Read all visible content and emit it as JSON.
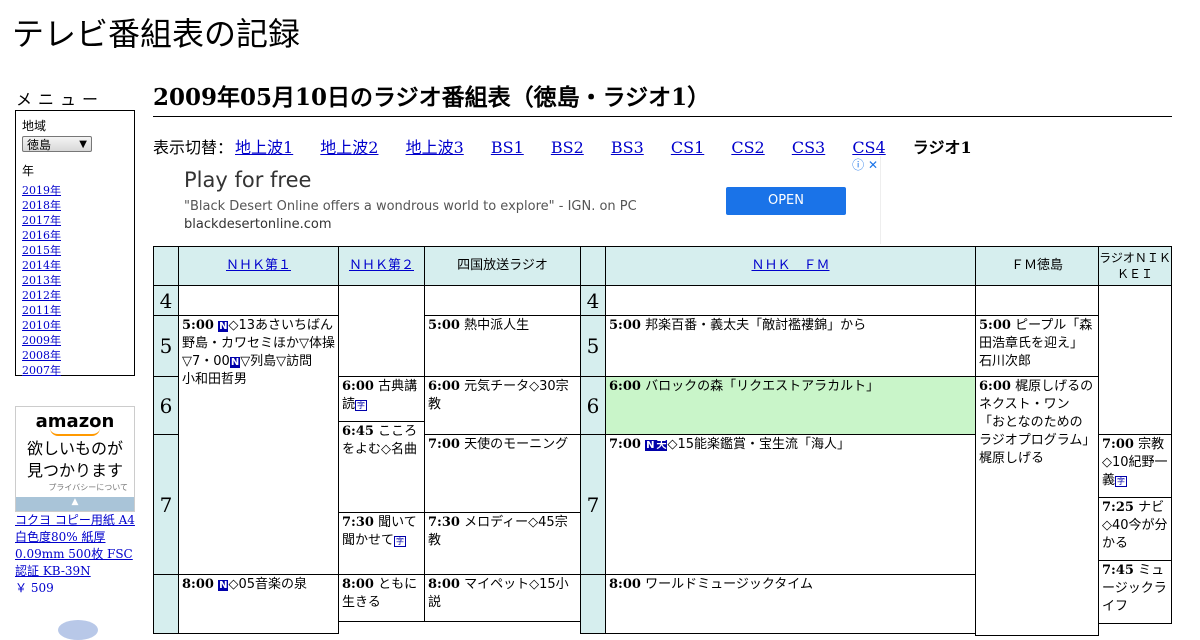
{
  "site": {
    "title": "テレビ番組表の記録"
  },
  "menu": {
    "heading": "メニュー",
    "region_label": "地域",
    "region_value": "徳島",
    "year_label": "年",
    "years": [
      "2019年",
      "2018年",
      "2017年",
      "2016年",
      "2015年",
      "2014年",
      "2013年",
      "2012年",
      "2011年",
      "2010年",
      "2009年",
      "2008年",
      "2007年"
    ]
  },
  "amazon_ad": {
    "logo": "amazon",
    "tagline1": "欲しいものが",
    "tagline2": "見つかります",
    "privacy": "プライバシーについて"
  },
  "product": {
    "name": "コクヨ コピー用紙 A4 白色度80% 紙厚 0.09mm 500枚 FSC認証 KB-39N",
    "price": "￥ 509"
  },
  "page": {
    "title": "2009年05月10日のラジオ番組表（徳島・ラジオ1）"
  },
  "switcher": {
    "label": "表示切替：",
    "links": [
      "地上波1",
      "地上波2",
      "地上波3",
      "BS1",
      "BS2",
      "BS3",
      "CS1",
      "CS2",
      "CS3",
      "CS4"
    ],
    "current": "ラジオ1"
  },
  "ad": {
    "headline": "Play for free",
    "description": "\"Black Desert Online offers a wondrous world to explore\" - IGN. on PC",
    "url": "blackdesertonline.com",
    "button": "OPEN"
  },
  "channels": [
    "ＮＨＫ第１",
    "ＮＨＫ第２",
    "四国放送ラジオ",
    "ＮＨＫ　ＦＭ",
    "ＦＭ徳島",
    "ラジオＮＩＫＫＥＩ"
  ],
  "hours": [
    "4",
    "5",
    "6",
    "7"
  ],
  "programs": {
    "nhk1_500_time": "5:00",
    "nhk1_500_a": "◇13あさいちばん　野島・カワセミほか▽体操▽7・00",
    "nhk1_500_b": "▽列島▽訪問　小和田哲男",
    "nhk1_800_time": "8:00",
    "nhk1_800": "◇05音楽の泉",
    "nhk2_600_time": "6:00",
    "nhk2_600": "古典講読",
    "nhk2_645_time": "6:45",
    "nhk2_645": "こころをよむ◇名曲",
    "nhk2_730_time": "7:30",
    "nhk2_730": "聞いて聞かせて",
    "nhk2_800_time": "8:00",
    "nhk2_800": "ともに生きる",
    "jrt_500_time": "5:00",
    "jrt_500": "熱中派人生",
    "jrt_600_time": "6:00",
    "jrt_600": "元気チータ◇30宗教",
    "jrt_700_time": "7:00",
    "jrt_700": "天使のモーニング",
    "jrt_730_time": "7:30",
    "jrt_730": "メロディー◇45宗教",
    "jrt_800_time": "8:00",
    "jrt_800": "マイペット◇15小説",
    "fm_500_time": "5:00",
    "fm_500": "邦楽百番・義太夫「敵討襤褸錦」から",
    "fm_600_time": "6:00",
    "fm_600": "バロックの森「リクエストアラカルト」",
    "fm_700_time": "7:00",
    "fm_700": "◇15能楽鑑賞・宝生流「海人」",
    "fm_800_time": "8:00",
    "fm_800": "ワールドミュージックタイム",
    "fmt_500_time": "5:00",
    "fmt_500": "ピープル「森田浩章氏を迎え」石川次郎",
    "fmt_600_time": "6:00",
    "fmt_600": "梶原しげるのネクスト・ワン「おとなのためのラジオプログラム」梶原しげる",
    "nk_700_time": "7:00",
    "nk_700": "宗教◇10紀野一義",
    "nk_725_time": "7:25",
    "nk_725": "ナビ◇40今が分かる",
    "nk_745_time": "7:45",
    "nk_745": "ミュージックライフ"
  },
  "badges": {
    "n": "N",
    "s": "字",
    "ten": "天"
  },
  "colors": {
    "header_bg": "#d6eeee",
    "highlight_bg": "#c9f5c9",
    "link": "#0000cc"
  }
}
